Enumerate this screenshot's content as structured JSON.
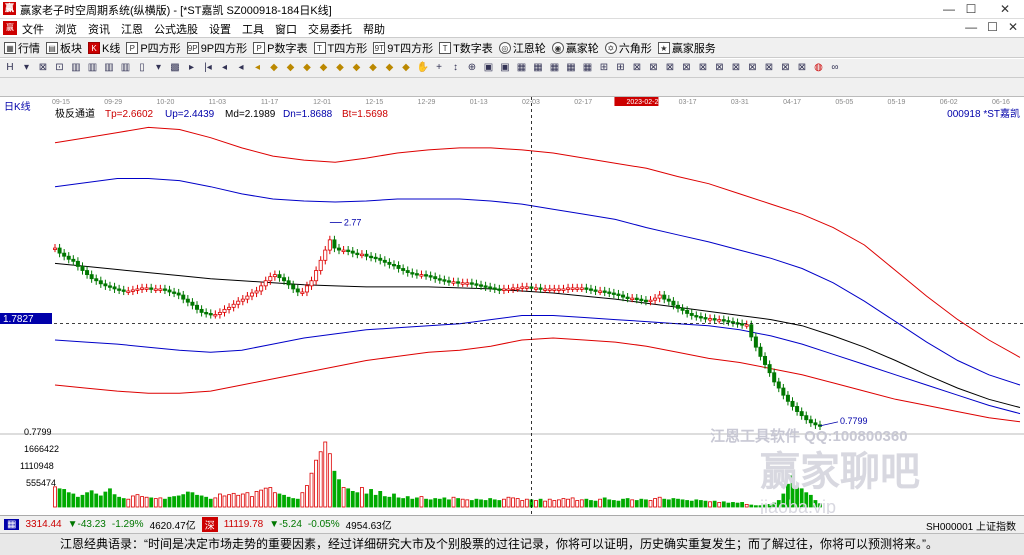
{
  "window": {
    "title": "赢家老子时空周期系统(纵横版) - [*ST嘉凯  SZ000918-184日K线]",
    "app_icon": "赢",
    "min": "—",
    "max": "☐",
    "close": "✕"
  },
  "menu": {
    "logo": "赢",
    "items": [
      "文件",
      "浏览",
      "资讯",
      "江恩",
      "公式选股",
      "设置",
      "工具",
      "窗口",
      "交易委托",
      "帮助"
    ],
    "right": [
      "—",
      "☐",
      "✕"
    ]
  },
  "toolbar": {
    "buttons": [
      {
        "label": "行情",
        "icon": "grid-icon"
      },
      {
        "label": "板块",
        "icon": "blocks-icon"
      },
      {
        "label": "K线",
        "icon": "kline-icon"
      },
      {
        "label": "P四方形",
        "icon": "p-square-icon"
      },
      {
        "label": "9P四方形",
        "icon": "9p-square-icon"
      },
      {
        "label": "P数字表",
        "icon": "p-table-icon"
      },
      {
        "label": "T四方形",
        "icon": "t-square-icon"
      },
      {
        "label": "9T四方形",
        "icon": "9t-square-icon"
      },
      {
        "label": "T数字表",
        "icon": "t-table-icon"
      },
      {
        "label": "江恩轮",
        "icon": "gann-wheel-icon"
      },
      {
        "label": "赢家轮",
        "icon": "winner-wheel-icon"
      },
      {
        "label": "六角形",
        "icon": "hexagon-icon"
      },
      {
        "label": "赢家服务",
        "icon": "service-icon"
      }
    ]
  },
  "chart_header": {
    "period": "日K线",
    "indicator": "极反通道",
    "tp": "Tp=2.6602",
    "up": "Up=2.4439",
    "md": "Md=2.1989",
    "dn": "Dn=1.8688",
    "bt": "Bt=1.5698",
    "stock": "000918 *ST嘉凯",
    "price_label": "1.7827",
    "volume_ticks": [
      "1666422",
      "1110948",
      "555474"
    ],
    "min_price_label": "0.7799",
    "watermark1": "江恩工具软件  QQ:100800360",
    "watermark2": "赢家聊吧",
    "watermark3": "jiaoba.vip"
  },
  "chart_data": {
    "type": "candlestick",
    "date_ticks": [
      "09-15",
      "09-29",
      "10-20",
      "11-03",
      "11-17",
      "12-01",
      "12-15",
      "12-29",
      "01-13",
      "02-03",
      "02-17",
      "2023-02-27",
      "03-17",
      "03-31",
      "04-17",
      "05-05",
      "05-19",
      "06-02",
      "06-16"
    ],
    "crosshair_date": "2023-02-27",
    "crosshair_price": 1.7827,
    "high_label": 2.77,
    "low_label": 0.7799,
    "price_ylim": [
      0.72,
      3.9
    ],
    "close": [
      2.52,
      2.47,
      2.44,
      2.41,
      2.39,
      2.34,
      2.3,
      2.26,
      2.22,
      2.2,
      2.17,
      2.15,
      2.14,
      2.12,
      2.11,
      2.1,
      2.1,
      2.11,
      2.12,
      2.13,
      2.13,
      2.12,
      2.12,
      2.12,
      2.11,
      2.09,
      2.08,
      2.06,
      2.02,
      1.99,
      1.96,
      1.92,
      1.89,
      1.88,
      1.87,
      1.87,
      1.89,
      1.92,
      1.94,
      1.97,
      2.0,
      2.02,
      2.05,
      2.08,
      2.1,
      2.15,
      2.2,
      2.24,
      2.26,
      2.23,
      2.2,
      2.16,
      2.12,
      2.09,
      2.09,
      2.15,
      2.2,
      2.3,
      2.4,
      2.5,
      2.6,
      2.52,
      2.5,
      2.5,
      2.49,
      2.47,
      2.46,
      2.46,
      2.44,
      2.43,
      2.42,
      2.4,
      2.38,
      2.36,
      2.35,
      2.32,
      2.3,
      2.28,
      2.27,
      2.26,
      2.26,
      2.25,
      2.24,
      2.22,
      2.21,
      2.2,
      2.19,
      2.19,
      2.18,
      2.18,
      2.18,
      2.17,
      2.16,
      2.15,
      2.14,
      2.13,
      2.12,
      2.11,
      2.12,
      2.12,
      2.13,
      2.13,
      2.14,
      2.14,
      2.13,
      2.13,
      2.12,
      2.12,
      2.12,
      2.12,
      2.12,
      2.12,
      2.13,
      2.13,
      2.13,
      2.13,
      2.12,
      2.11,
      2.1,
      2.1,
      2.09,
      2.08,
      2.07,
      2.06,
      2.04,
      2.03,
      2.03,
      2.02,
      2.01,
      2.0,
      2.01,
      2.03,
      2.06,
      2.02,
      2.0,
      1.96,
      1.93,
      1.91,
      1.88,
      1.86,
      1.85,
      1.84,
      1.83,
      1.83,
      1.82,
      1.82,
      1.81,
      1.8,
      1.79,
      1.78,
      1.77,
      1.77,
      1.65,
      1.55,
      1.46,
      1.38,
      1.3,
      1.21,
      1.15,
      1.08,
      1.02,
      0.97,
      0.92,
      0.88,
      0.84,
      0.81,
      0.79,
      0.78
    ],
    "volume": [
      0.31,
      0.28,
      0.27,
      0.22,
      0.2,
      0.15,
      0.18,
      0.22,
      0.25,
      0.2,
      0.17,
      0.23,
      0.28,
      0.19,
      0.15,
      0.13,
      0.12,
      0.17,
      0.19,
      0.16,
      0.15,
      0.14,
      0.13,
      0.14,
      0.12,
      0.15,
      0.16,
      0.17,
      0.19,
      0.23,
      0.22,
      0.18,
      0.17,
      0.15,
      0.12,
      0.14,
      0.2,
      0.17,
      0.19,
      0.21,
      0.18,
      0.2,
      0.22,
      0.16,
      0.24,
      0.26,
      0.29,
      0.3,
      0.22,
      0.2,
      0.18,
      0.15,
      0.13,
      0.12,
      0.22,
      0.33,
      0.52,
      0.72,
      0.85,
      1.0,
      0.82,
      0.55,
      0.42,
      0.3,
      0.28,
      0.24,
      0.22,
      0.3,
      0.2,
      0.27,
      0.18,
      0.24,
      0.16,
      0.15,
      0.2,
      0.14,
      0.13,
      0.16,
      0.12,
      0.14,
      0.16,
      0.12,
      0.11,
      0.13,
      0.12,
      0.14,
      0.11,
      0.15,
      0.13,
      0.12,
      0.11,
      0.1,
      0.12,
      0.11,
      0.1,
      0.13,
      0.11,
      0.1,
      0.12,
      0.15,
      0.14,
      0.13,
      0.1,
      0.12,
      0.11,
      0.1,
      0.12,
      0.09,
      0.12,
      0.1,
      0.11,
      0.13,
      0.12,
      0.14,
      0.1,
      0.11,
      0.12,
      0.1,
      0.09,
      0.12,
      0.14,
      0.11,
      0.1,
      0.09,
      0.12,
      0.13,
      0.11,
      0.1,
      0.12,
      0.11,
      0.1,
      0.13,
      0.15,
      0.12,
      0.11,
      0.13,
      0.12,
      0.11,
      0.1,
      0.09,
      0.11,
      0.1,
      0.09,
      0.08,
      0.09,
      0.07,
      0.08,
      0.06,
      0.07,
      0.06,
      0.07,
      0.04,
      0.03,
      0.02,
      0.02,
      0.03,
      0.04,
      0.06,
      0.1,
      0.2,
      0.35,
      0.48,
      0.32,
      0.28,
      0.22,
      0.18,
      0.1,
      0.05
    ],
    "bands": {
      "tp": [
        3.55,
        3.6,
        3.65,
        3.7,
        3.68,
        3.6,
        3.5,
        3.42,
        3.38,
        3.36,
        3.4,
        3.45,
        3.48,
        3.5,
        3.5,
        3.48,
        3.45,
        3.4,
        3.35,
        3.3,
        3.22,
        3.15,
        3.05,
        2.95,
        2.85,
        2.72,
        2.55,
        2.3,
        2.05,
        1.82,
        1.62,
        1.45
      ],
      "up": [
        3.12,
        3.16,
        3.2,
        3.2,
        3.18,
        3.12,
        3.05,
        3.0,
        2.98,
        2.97,
        2.98,
        3.0,
        3.0,
        3.0,
        2.98,
        2.95,
        2.9,
        2.85,
        2.8,
        2.72,
        2.65,
        2.58,
        2.5,
        2.42,
        2.32,
        2.18,
        2.0,
        1.8,
        1.6,
        1.42,
        1.28,
        1.18
      ],
      "md": [
        2.37,
        2.34,
        2.31,
        2.28,
        2.25,
        2.22,
        2.2,
        2.18,
        2.16,
        2.15,
        2.14,
        2.14,
        2.14,
        2.13,
        2.12,
        2.1,
        2.08,
        2.05,
        2.02,
        1.98,
        1.94,
        1.9,
        1.86,
        1.82,
        1.76,
        1.66,
        1.55,
        1.42,
        1.28,
        1.15,
        1.04,
        0.96
      ],
      "dn": [
        1.62,
        1.6,
        1.58,
        1.55,
        1.52,
        1.5,
        1.52,
        1.58,
        1.64,
        1.68,
        1.72,
        1.74,
        1.76,
        1.78,
        1.82,
        1.86,
        1.86,
        1.84,
        1.82,
        1.8,
        1.78,
        1.76,
        1.72,
        1.66,
        1.58,
        1.48,
        1.38,
        1.28,
        1.18,
        1.08,
        0.98,
        0.9
      ],
      "bt": [
        1.18,
        1.15,
        1.12,
        1.1,
        1.1,
        1.12,
        1.18,
        1.24,
        1.3,
        1.36,
        1.42,
        1.46,
        1.5,
        1.52,
        1.56,
        1.62,
        1.64,
        1.62,
        1.6,
        1.56,
        1.5,
        1.44,
        1.4,
        1.34,
        1.28,
        1.2,
        1.12,
        1.04,
        0.98,
        0.92,
        0.86,
        0.82
      ]
    }
  },
  "status": {
    "sh": "3314.44",
    "sh_chg": "▼-43.23",
    "sh_pct": "-1.29%",
    "sh_amt": "4620.47亿",
    "sz": "11119.78",
    "sz_chg": "▼-5.24",
    "sz_pct": "-0.05%",
    "sz_amt": "4954.63亿",
    "code": "SH000001 上证指数"
  },
  "bottom": {
    "quote": "江恩经典语录：“时间是决定市场走势的重要因素，经过详细研究大市及个别股票的过往记录，你将可以证明，历史确实重复发生；而了解过往，你将可以预测将来。”。"
  }
}
